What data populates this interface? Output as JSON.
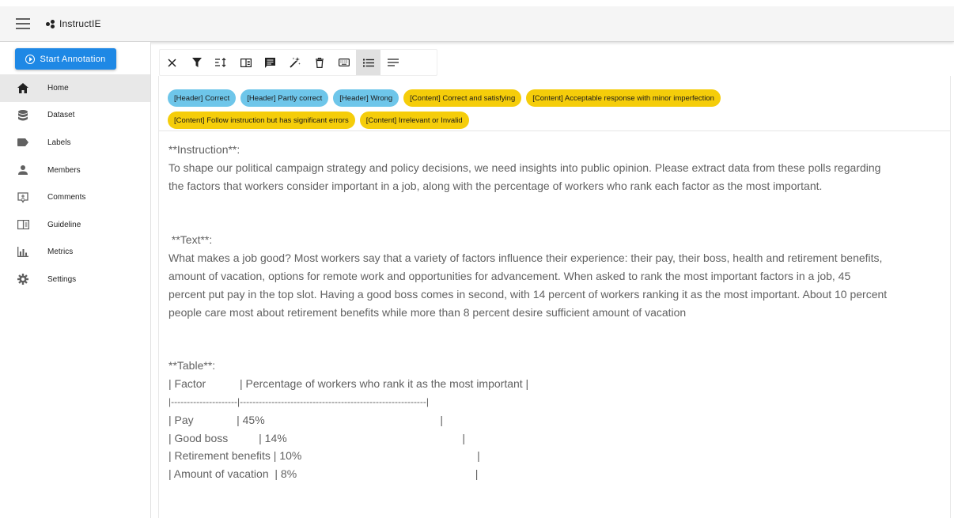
{
  "app": {
    "title": "InstructIE"
  },
  "sidebar": {
    "start_button": "Start Annotation",
    "items": [
      {
        "label": "Home",
        "icon": "home-icon"
      },
      {
        "label": "Dataset",
        "icon": "database-icon"
      },
      {
        "label": "Labels",
        "icon": "label-icon"
      },
      {
        "label": "Members",
        "icon": "person-icon"
      },
      {
        "label": "Comments",
        "icon": "comment-icon"
      },
      {
        "label": "Guideline",
        "icon": "book-icon"
      },
      {
        "label": "Metrics",
        "icon": "bar-chart-icon"
      },
      {
        "label": "Settings",
        "icon": "gear-icon"
      }
    ],
    "active": "Home"
  },
  "toolbar": {
    "buttons": [
      "close-icon",
      "filter-icon",
      "sort-icon",
      "split-view-icon",
      "comment-icon",
      "auto-label-icon",
      "delete-icon",
      "keyboard-icon",
      "list-icon",
      "text-icon"
    ],
    "active": "list-icon"
  },
  "labels": {
    "row1": [
      {
        "text": "[Header] Correct",
        "color": "#6ec6ea"
      },
      {
        "text": "[Header] Partly correct",
        "color": "#6ec6ea"
      },
      {
        "text": "[Header] Wrong",
        "color": "#6ec6ea"
      },
      {
        "text": "[Content] Correct and satisfying",
        "color": "#f5cd0a"
      },
      {
        "text": "[Content] Acceptable response with minor imperfection",
        "color": "#f5cd0a"
      }
    ],
    "row2": [
      {
        "text": "[Content] Follow instruction but has significant errors",
        "color": "#f5cd0a"
      },
      {
        "text": "[Content] Irrelevant or Invalid",
        "color": "#f5cd0a"
      }
    ]
  },
  "document": {
    "instruction_heading": "**Instruction**:",
    "instruction_line1": "To shape our political campaign strategy and policy decisions, we need insights into public opinion. Please extract data from these polls regarding",
    "instruction_line2": "the factors that workers consider important in a job, along with the percentage of workers who rank each factor as the most important.",
    "text_heading": " **Text**:",
    "text_line1": "What makes a job good? Most workers say that a variety of factors influence their experience: their pay, their boss, health and retirement benefits,",
    "text_line2": "amount of vacation, options for remote work and opportunities for advancement. When asked to rank the most important factors in a job, 45",
    "text_line3": "percent put pay in the top slot. Having a good boss comes in second, with 14 percent of workers ranking it as the most important. About 10 percent",
    "text_line4": "people care most about retirement benefits while more than 8 percent desire sufficient amount of vacation",
    "table_heading": "**Table**:",
    "table_header": "| Factor           | Percentage of workers who rank it as the most important |",
    "table_sep": "|---------------------|-----------------------------------------------------------|",
    "table_row1": "| Pay              | 45%                                                         |",
    "table_row2": "| Good boss          | 14%                                                         |",
    "table_row3": "| Retirement benefits | 10%                                                         |",
    "table_row4": "| Amount of vacation  | 8%                                                          |"
  }
}
